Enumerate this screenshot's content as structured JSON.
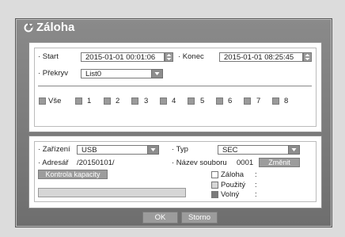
{
  "dialog": {
    "title": "Záloha"
  },
  "range": {
    "start_label": "· Start",
    "start_value": "2015-01-01 00:01:06",
    "end_label": "· Konec",
    "end_value": "2015-01-01 08:25:45",
    "overlap_label": "· Překryv",
    "overlap_value": "List0"
  },
  "channels": {
    "all_label": "Vše",
    "items": [
      "1",
      "2",
      "3",
      "4",
      "5",
      "6",
      "7",
      "8"
    ]
  },
  "device": {
    "device_label": "· Zařízení",
    "device_value": "USB",
    "type_label": "· Typ",
    "type_value": "SEC",
    "folder_label": "· Adresář",
    "folder_value": "/20150101/",
    "filename_label": "· Název souboru",
    "filename_value": "0001",
    "change_button": "Změnit",
    "capacity_button": "Kontrola kapacity",
    "legend": [
      {
        "label": "Záloha",
        "sep": ":",
        "color": "#ffffff"
      },
      {
        "label": "Použitý",
        "sep": ":",
        "color": "#d6d6d6"
      },
      {
        "label": "Volný",
        "sep": ":",
        "color": "#7a7a7a"
      }
    ]
  },
  "footer": {
    "ok": "OK",
    "cancel": "Storno"
  }
}
